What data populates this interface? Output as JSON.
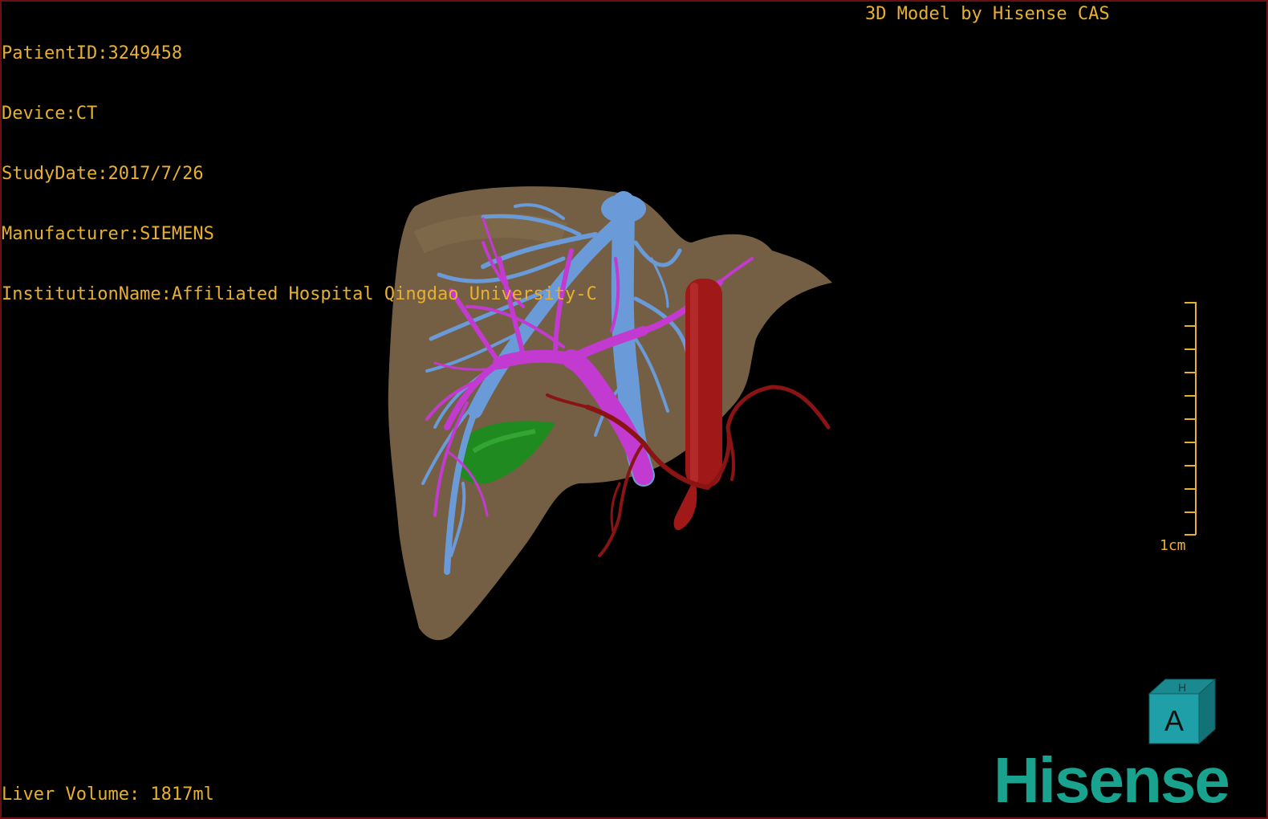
{
  "viewer": {
    "patient_id": "PatientID:3249458",
    "device": "Device:CT",
    "study_date": "StudyDate:2017/7/26",
    "manufacturer": "Manufacturer:SIEMENS",
    "institution": "InstitutionName:Affiliated Hospital Qingdao University-C",
    "credit": "3D Model by Hisense CAS",
    "liver_volume": "Liver Volume: 1817ml"
  },
  "scale": {
    "label": "1cm"
  },
  "orientation_cube": {
    "front_label": "A",
    "top_label": "H"
  },
  "brand": {
    "logo_text": "Hisense"
  },
  "colors": {
    "hud_text": "#e8b030",
    "liver": "#7a6448",
    "hepatic_vein": "#6a9ad8",
    "portal_vein": "#c23ad0",
    "artery": "#8a1414",
    "ivc": "#a01818",
    "gallbladder": "#1f8a1f",
    "brand": "#19a38f"
  }
}
